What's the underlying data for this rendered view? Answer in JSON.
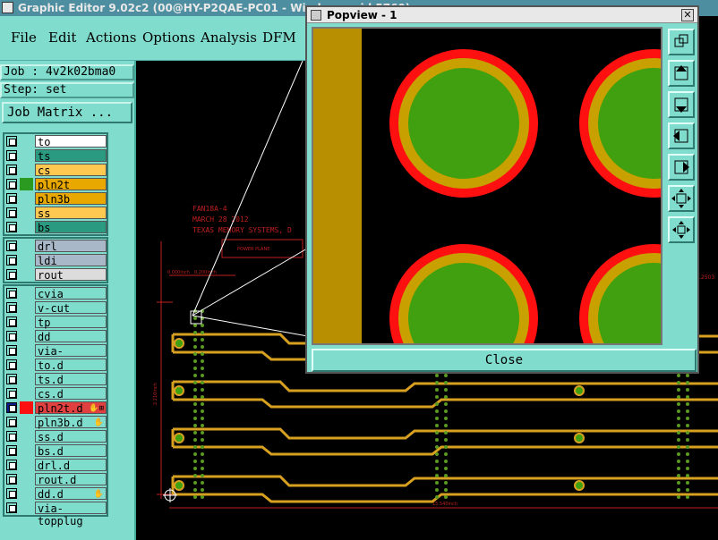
{
  "window": {
    "title": "Graphic Editor 9.02c2 (00@HY-P2QAE-PC01 - Windows, pid 5760)"
  },
  "menu": [
    "File",
    "Edit",
    "Actions",
    "Options",
    "Analysis",
    "DFM"
  ],
  "job": {
    "label": "Job : ",
    "value": "4v2k02bma0"
  },
  "step": {
    "label": "Step: ",
    "value": "set"
  },
  "job_matrix_button": "Job Matrix ...",
  "layers_group1": [
    {
      "name": "to",
      "color": "#ffffff"
    },
    {
      "name": "ts",
      "color": "#2a9a80"
    },
    {
      "name": "cs",
      "color": "#ffc850"
    },
    {
      "name": "pln2t",
      "color": "#e8a800",
      "swatch": "#2a9a20"
    },
    {
      "name": "pln3b",
      "color": "#e8a800"
    },
    {
      "name": "ss",
      "color": "#ffc850"
    },
    {
      "name": "bs",
      "color": "#2a9a80"
    }
  ],
  "layers_group2": [
    {
      "name": "drl",
      "color": "#a8b8c8"
    },
    {
      "name": "ldi",
      "color": "#a8b8c8"
    },
    {
      "name": "rout",
      "color": "#dcdcdc"
    }
  ],
  "layers_group3": [
    {
      "name": "cvia",
      "color": "#80dccc"
    },
    {
      "name": "v-cut",
      "color": "#80dccc"
    },
    {
      "name": "tp",
      "color": "#80dccc"
    },
    {
      "name": "dd",
      "color": "#80dccc"
    },
    {
      "name": "via-topplug",
      "color": "#80dccc"
    },
    {
      "name": "to.d",
      "color": "#80dccc"
    },
    {
      "name": "ts.d",
      "color": "#80dccc"
    },
    {
      "name": "cs.d",
      "color": "#80dccc"
    },
    {
      "name": "pln2t.d",
      "color": "#e04040",
      "active": true,
      "icon": "✋⊞"
    },
    {
      "name": "pln3b.d",
      "color": "#80dccc",
      "icon": "✋"
    },
    {
      "name": "ss.d",
      "color": "#80dccc"
    },
    {
      "name": "bs.d",
      "color": "#80dccc"
    },
    {
      "name": "drl.d",
      "color": "#80dccc"
    },
    {
      "name": "rout.d",
      "color": "#80dccc"
    },
    {
      "name": "dd.d",
      "color": "#80dccc",
      "icon": "✋"
    },
    {
      "name": "via-topplug",
      "color": "#80dccc"
    }
  ],
  "board_text": {
    "line1": "FAN18A-4",
    "line2": "MARCH 28 2012",
    "line3": "TEXAS MEMORY SYSTEMS, D",
    "box": "POWER PLANE",
    "dim_top1": "0.000inch",
    "dim_top2": "0.200inch",
    "dim_left": "2.210inch",
    "dim_bottom": "15.540inch",
    "dim_right": ".2503"
  },
  "popview": {
    "title": "Popview - 1",
    "close_label": "Close",
    "tools": [
      "zoom-fit-icon",
      "zoom-up-icon",
      "zoom-down-icon",
      "pan-left-icon",
      "pan-right-icon",
      "zoom-extents-icon",
      "pan-all-icon"
    ]
  },
  "colors": {
    "panel": "#80dccc",
    "pad_outer": "#ff1010",
    "pad_mid": "#c8a000",
    "pad_inner": "#40a010",
    "trace": "#d8a020"
  }
}
